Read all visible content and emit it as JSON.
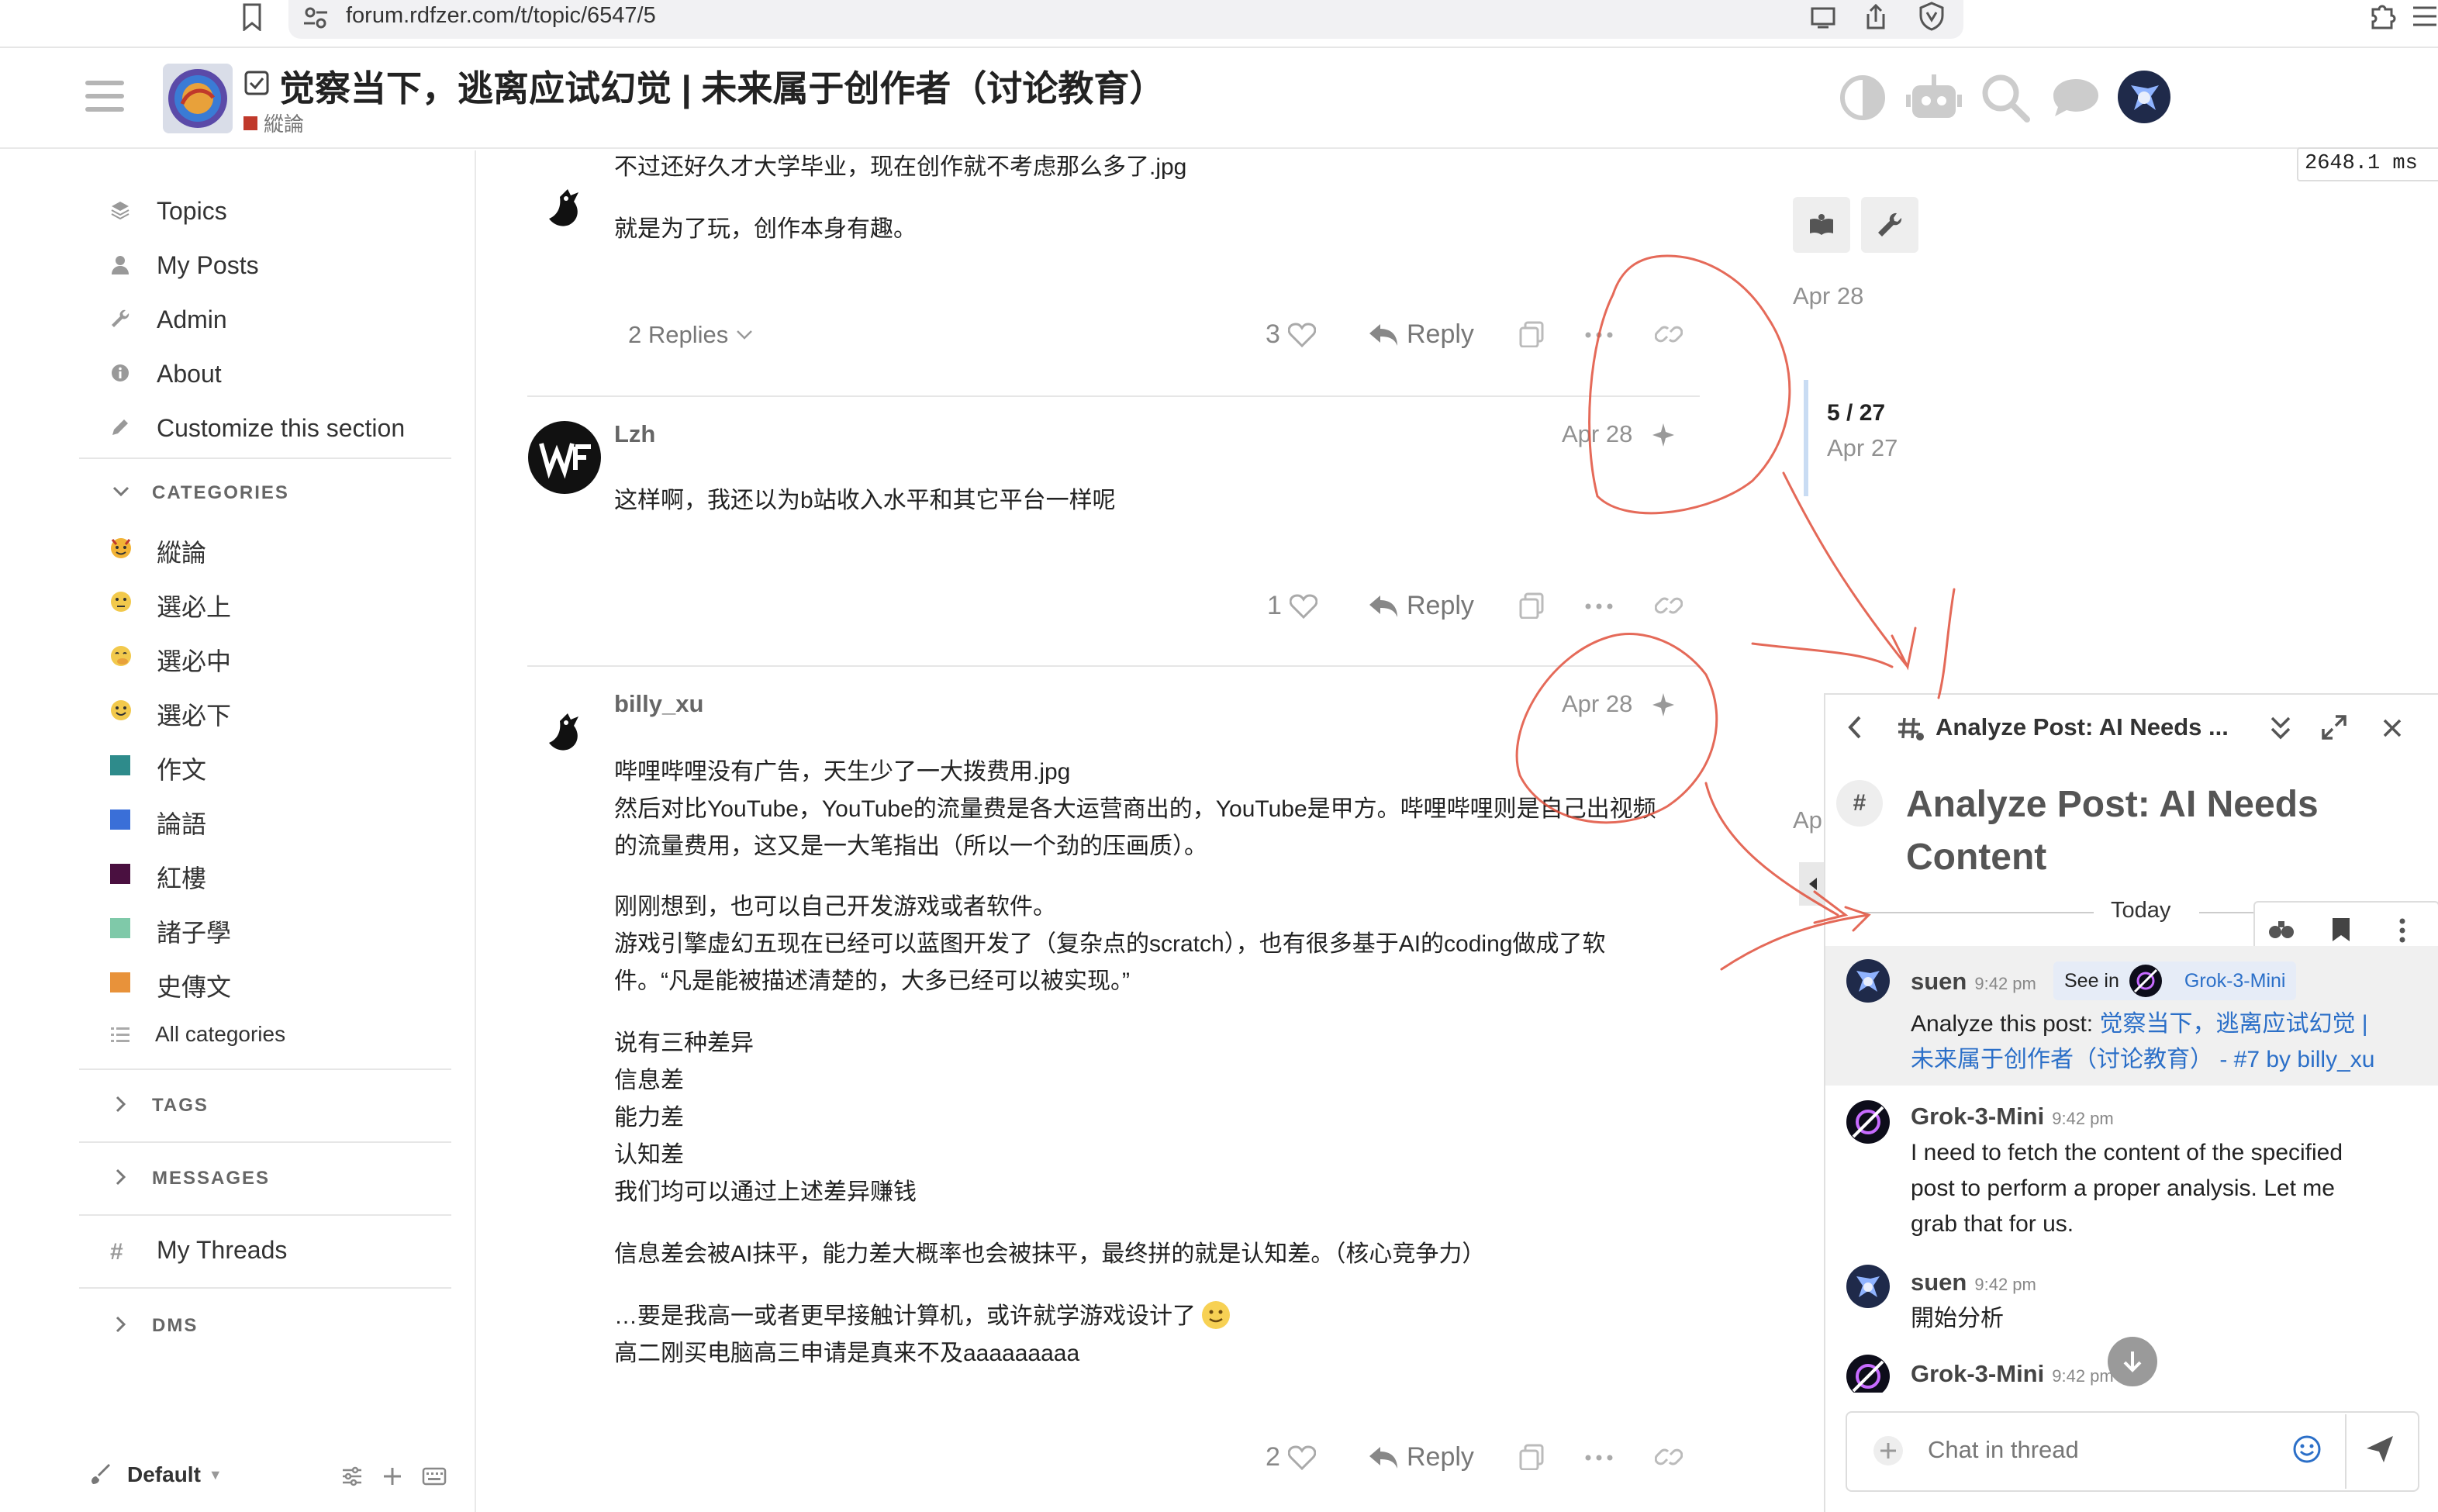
{
  "browser": {
    "url": "forum.rdfzer.com/t/topic/6547/5"
  },
  "header": {
    "title": "觉察当下，逃离应试幻觉 | 未来属于创作者（讨论教育）",
    "category": "縱論",
    "category_color": "#c0392b"
  },
  "perf": {
    "ms": "2648.1 ms"
  },
  "sidebar": {
    "items": [
      {
        "label": "Topics",
        "icon": "layers-icon"
      },
      {
        "label": "My Posts",
        "icon": "user-icon"
      },
      {
        "label": "Admin",
        "icon": "wrench-icon"
      },
      {
        "label": "About",
        "icon": "info-icon"
      },
      {
        "label": "Customize this section",
        "icon": "pencil-icon"
      }
    ],
    "categories_heading": "CATEGORIES",
    "categories": [
      {
        "label": "縱論"
      },
      {
        "label": "選必上"
      },
      {
        "label": "選必中"
      },
      {
        "label": "選必下"
      },
      {
        "label": "作文",
        "color": "#2e8b8b"
      },
      {
        "label": "論語",
        "color": "#3a6fd8"
      },
      {
        "label": "紅樓",
        "color": "#4a1040"
      },
      {
        "label": "諸子學",
        "color": "#7fc9a9"
      },
      {
        "label": "史傳文",
        "color": "#e8923a"
      }
    ],
    "all_categories": "All categories",
    "tags_heading": "TAGS",
    "messages_heading": "MESSAGES",
    "my_threads": "My Threads",
    "dms_heading": "DMS",
    "theme_label": "Default"
  },
  "posts": [
    {
      "lines": [
        "不过还好久才大学毕业，现在创作就不考虑那么多了.jpg",
        "就是为了玩，创作本身有趣。"
      ],
      "replies": "2 Replies",
      "likes": "3",
      "reply_label": "Reply"
    },
    {
      "username": "Lzh",
      "date": "Apr 28",
      "lines": [
        "这样啊，我还以为b站收入水平和其它平台一样呢"
      ],
      "likes": "1",
      "reply_label": "Reply"
    },
    {
      "username": "billy_xu",
      "date": "Apr 28",
      "lines": [
        "哔哩哔哩没有广告，天生少了一大拨费用.jpg",
        "然后对比YouTube，YouTube的流量费是各大运营商出的，YouTube是甲方。哔哩哔哩则是自己出视频",
        "的流量费用，这又是一大笔指出（所以一个劲的压画质）。",
        "刚刚想到，也可以自己开发游戏或者软件。",
        "游戏引擎虚幻五现在已经可以蓝图开发了（复杂点的scratch），也有很多基于AI的coding做成了软",
        "件。“凡是能被描述清楚的，大多已经可以被实现。”",
        "说有三种差异",
        "信息差",
        "能力差",
        "认知差",
        "我们均可以通过上述差异赚钱",
        "信息差会被AI抹平，能力差大概率也会被抹平，最终拼的就是认知差。（核心竞争力）",
        "…要是我高一或者更早接触计算机，或许就学游戏设计了",
        "高二刚买电脑高三申请是真来不及aaaaaaaaa"
      ],
      "likes": "2",
      "reply_label": "Reply"
    }
  ],
  "timeline": {
    "top_date": "Apr 28",
    "position": "5 / 27",
    "position_date": "Apr 27",
    "cut_date": "Ap"
  },
  "chat": {
    "header_title": "Analyze Post: AI Needs ...",
    "thread_title_line1": "Analyze Post: AI Needs",
    "thread_title_line2": "Content",
    "divider": "Today",
    "messages": [
      {
        "user": "suen",
        "time": "9:42 pm",
        "see_in": "See in",
        "see_in_target": "Grok-3-Mini",
        "text_prefix": "Analyze this post: ",
        "link_line1": "觉察当下，逃离应试幻觉 |",
        "link_line2": "未来属于创作者（讨论教育） - #7 by billy_xu"
      },
      {
        "user": "Grok-3-Mini",
        "time": "9:42 pm",
        "lines": [
          "I need to fetch the content of the specified",
          "post to perform a proper analysis. Let me",
          "grab that for us."
        ]
      },
      {
        "user": "suen",
        "time": "9:42 pm",
        "lines": [
          "開始分析"
        ]
      },
      {
        "user": "Grok-3-Mini",
        "time": "9:42 pm",
        "lines": []
      }
    ],
    "composer_placeholder": "Chat in thread"
  },
  "annotation_color": "#e0503c"
}
